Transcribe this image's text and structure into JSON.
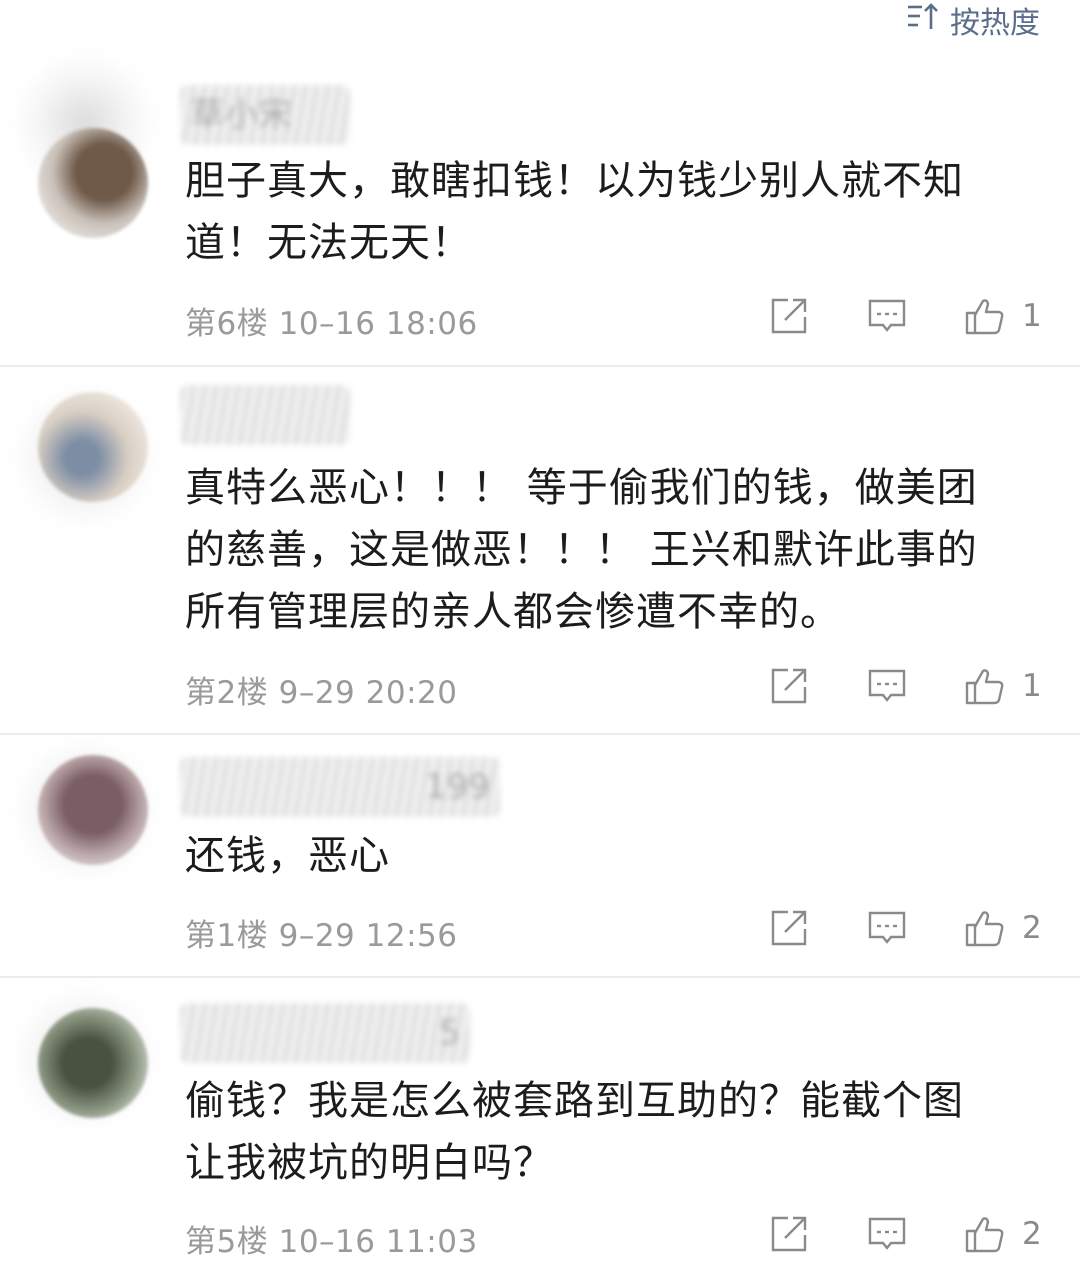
{
  "sort": {
    "label": "按热度",
    "icon": "sort-icon"
  },
  "comments": [
    {
      "username": "草小宋",
      "text_lines": [
        "胆子真大，敢瞎扣钱！以为钱少别人就不知",
        "道！无法无天！"
      ],
      "floor": "第6楼",
      "time": "10–16 18:06",
      "likes": "1",
      "avatar_color": "#8f7a66"
    },
    {
      "username": "",
      "text_lines": [
        "真特么恶心！！！  等于偷我们的钱，做美团",
        "的慈善，这是做恶！！！  王兴和默许此事的",
        "所有管理层的亲人都会惨遭不幸的。"
      ],
      "floor": "第2楼",
      "time": "9–29 20:20",
      "likes": "1",
      "avatar_color": "#b9a997"
    },
    {
      "username": "199",
      "text_lines": [
        "还钱，恶心"
      ],
      "floor": "第1楼",
      "time": "9–29 12:56",
      "likes": "2",
      "avatar_color": "#8a6e72"
    },
    {
      "username": "5",
      "text_lines": [
        "偷钱？我是怎么被套路到互助的？能截个图",
        "让我被坑的明白吗？"
      ],
      "floor": "第5楼",
      "time": "10–16 11:03",
      "likes": "2",
      "avatar_color": "#5e6a5a"
    }
  ]
}
